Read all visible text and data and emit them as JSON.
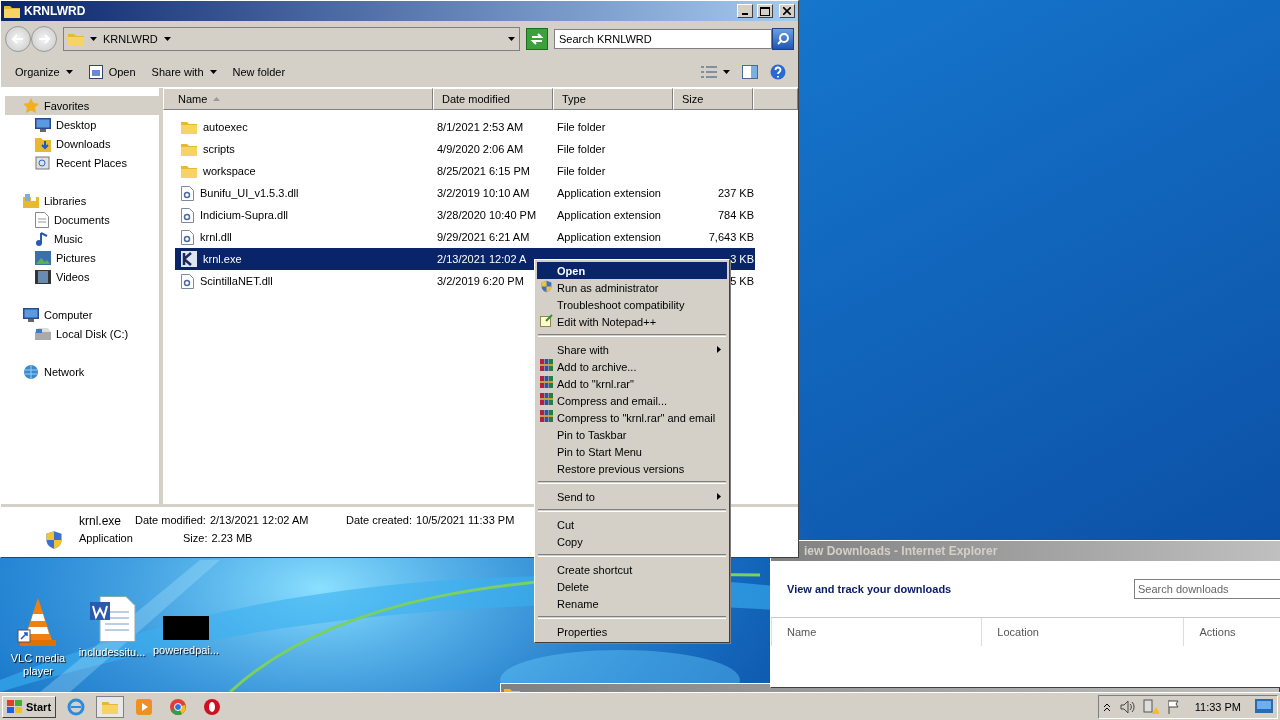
{
  "explorer": {
    "title": "KRNLWRD",
    "address": "KRNLWRD",
    "search": {
      "placeholder": "Search KRNLWRD"
    },
    "toolbar": [
      {
        "label": "Organize",
        "kind": "menu"
      },
      {
        "label": "Open",
        "kind": "icon"
      },
      {
        "label": "Share with",
        "kind": "menu"
      },
      {
        "label": "New folder",
        "kind": "plain"
      }
    ],
    "nav": [
      {
        "label": "Favorites",
        "selected": true,
        "children": [
          {
            "label": "Desktop",
            "selected": false
          },
          {
            "label": "Downloads",
            "selected": false
          },
          {
            "label": "Recent Places",
            "selected": false
          }
        ]
      },
      {
        "label": "Libraries",
        "selected": false,
        "children": [
          {
            "label": "Documents",
            "selected": false
          },
          {
            "label": "Music",
            "selected": false
          },
          {
            "label": "Pictures",
            "selected": false
          },
          {
            "label": "Videos",
            "selected": false
          }
        ]
      },
      {
        "label": "Computer",
        "selected": false,
        "children": [
          {
            "label": "Local Disk (C:)",
            "selected": false
          }
        ]
      },
      {
        "label": "Network",
        "selected": false
      }
    ],
    "columns": [
      {
        "label": "Name",
        "sorted": true
      },
      {
        "label": "Date modified",
        "sorted": false
      },
      {
        "label": "Type",
        "sorted": false
      },
      {
        "label": "Size",
        "sorted": false
      }
    ],
    "files": [
      {
        "name": "autoexec",
        "kind": "folder",
        "date": "8/1/2021 2:53 AM",
        "type": "File folder",
        "selected": false
      },
      {
        "name": "scripts",
        "kind": "folder",
        "date": "4/9/2020 2:06 AM",
        "type": "File folder",
        "selected": false
      },
      {
        "name": "workspace",
        "kind": "folder",
        "date": "8/25/2021 6:15 PM",
        "type": "File folder",
        "selected": false
      },
      {
        "name": "Bunifu_UI_v1.5.3.dll",
        "kind": "dll",
        "date": "3/2/2019 10:10 AM",
        "type": "Application extension",
        "size": "237 KB",
        "selected": false
      },
      {
        "name": "Indicium-Supra.dll",
        "kind": "dll",
        "date": "3/28/2020 10:40 PM",
        "type": "Application extension",
        "size": "784 KB",
        "selected": false
      },
      {
        "name": "krnl.dll",
        "kind": "dll",
        "date": "9/29/2021 6:21 AM",
        "type": "Application extension",
        "size": "7,643 KB",
        "selected": false
      },
      {
        "name": "krnl.exe",
        "kind": "exe",
        "date": "2/13/2021 12:02 A",
        "size": "3 KB",
        "selected": true
      },
      {
        "name": "ScintillaNET.dll",
        "kind": "dll",
        "date": "3/2/2019 6:20 PM",
        "size": "5 KB",
        "selected": false
      }
    ],
    "details": {
      "name": "krnl.exe",
      "type": "Application",
      "modified_label": "Date modified:",
      "modified": "2/13/2021 12:02 AM",
      "size_label": "Size:",
      "size": "2.23 MB",
      "created_label": "Date created:",
      "created": "10/5/2021 11:33 PM"
    }
  },
  "context_menu": [
    {
      "kind": "item",
      "label": "Open",
      "selected": true
    },
    {
      "kind": "item",
      "label": "Run as administrator",
      "selected": false
    },
    {
      "kind": "item",
      "label": "Troubleshoot compatibility",
      "selected": false
    },
    {
      "kind": "item",
      "label": "Edit with Notepad++",
      "selected": false
    },
    {
      "kind": "separator"
    },
    {
      "kind": "submenu",
      "label": "Share with",
      "selected": false
    },
    {
      "kind": "item",
      "label": "Add to archive...",
      "selected": false
    },
    {
      "kind": "item",
      "label": "Add to \"krnl.rar\"",
      "selected": false
    },
    {
      "kind": "item",
      "label": "Compress and email...",
      "selected": false
    },
    {
      "kind": "item",
      "label": "Compress to \"krnl.rar\" and email",
      "selected": false
    },
    {
      "kind": "item",
      "label": "Pin to Taskbar",
      "selected": false
    },
    {
      "kind": "item",
      "label": "Pin to Start Menu",
      "selected": false
    },
    {
      "kind": "item",
      "label": "Restore previous versions",
      "selected": false
    },
    {
      "kind": "separator"
    },
    {
      "kind": "submenu",
      "label": "Send to",
      "selected": false
    },
    {
      "kind": "separator"
    },
    {
      "kind": "item",
      "label": "Cut",
      "selected": false
    },
    {
      "kind": "item",
      "label": "Copy",
      "selected": false
    },
    {
      "kind": "separator"
    },
    {
      "kind": "item",
      "label": "Create shortcut",
      "selected": false
    },
    {
      "kind": "item",
      "label": "Delete",
      "selected": false
    },
    {
      "kind": "item",
      "label": "Rename",
      "selected": false
    },
    {
      "kind": "separator"
    },
    {
      "kind": "item",
      "label": "Properties",
      "selected": false
    }
  ],
  "downloads_window": {
    "title": "iew Downloads - Internet Explorer",
    "heading": "View and track your downloads",
    "search": {
      "placeholder": "Search downloads"
    },
    "columns": [
      "Name",
      "Location",
      "Actions"
    ]
  },
  "desktop_icons": [
    {
      "label": "VLC media player",
      "kind": "vlc"
    },
    {
      "label": "includessitu...",
      "kind": "document"
    },
    {
      "label": "poweredpai...",
      "kind": "thumbnail"
    }
  ],
  "taskbar": {
    "start": "Start",
    "clock": "11:33 PM"
  }
}
